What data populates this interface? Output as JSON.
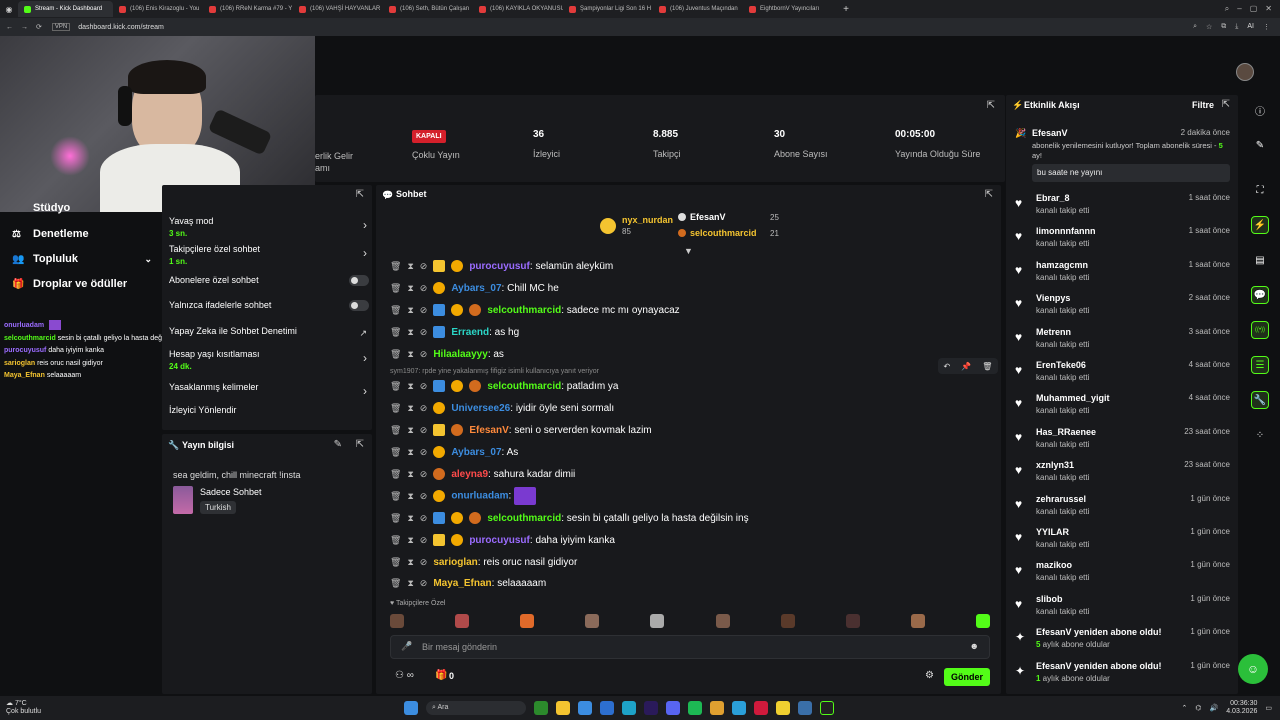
{
  "browser": {
    "tabs": [
      {
        "label": "Stream - Kick Dashboard",
        "active": true,
        "icon": "kick-icon"
      },
      {
        "label": "(106) Enis Kirazoglu - You"
      },
      {
        "label": "(106) RReN Karma #79 - Y"
      },
      {
        "label": "(106) VAHŞİ HAYVANLAR"
      },
      {
        "label": "(106) Seth, Bütün Çalışan"
      },
      {
        "label": "(106) KAYIKLA OKYANUSU"
      },
      {
        "label": "Şampiyonlar Ligi Son 16 H"
      },
      {
        "label": "(106) Juventus Maçından"
      },
      {
        "label": "EightbornV Yayıncıları"
      }
    ],
    "url": "dashboard.kick.com/stream",
    "ai_label": "AI"
  },
  "left_nav": {
    "items": [
      {
        "label": "Stüdyo"
      },
      {
        "label": "Denetleme",
        "icon": "gavel-icon"
      },
      {
        "label": "Topluluk",
        "icon": "users-icon"
      },
      {
        "label": "Droplar ve ödüller",
        "icon": "gift-icon"
      }
    ]
  },
  "overlay_chat": [
    {
      "user": "onurluadam",
      "text": "",
      "color": "#9b6cff"
    },
    {
      "user": "selcouthmarcid",
      "text": "sesin bi çatallı geliyo la hasta değilsin inş",
      "color": "#53fc18"
    },
    {
      "user": "purocuyusuf",
      "text": "daha iyiyim kanka",
      "color": "#9b6cff"
    },
    {
      "user": "sarioglan",
      "text": "reis oruc nasil gidiyor",
      "color": "#f4c430"
    },
    {
      "user": "Maya_Efnan",
      "text": "selaaaaam",
      "color": "#f4c430"
    }
  ],
  "stats": {
    "partial_label_1": "erlik Gelir",
    "partial_label_2": "amı",
    "status_badge": "KAPALI",
    "status_label": "Çoklu Yayın",
    "viewers_value": "36",
    "viewers_label": "İzleyici",
    "followers_value": "8.885",
    "followers_label": "Takipçi",
    "subs_value": "30",
    "subs_label": "Abone Sayısı",
    "uptime_value": "00:05:00",
    "uptime_label": "Yayında Olduğu Süre"
  },
  "chat_settings": {
    "items": [
      {
        "label": "Yavaş mod",
        "sub": "3 sn.",
        "control": "chevron"
      },
      {
        "label": "Takipçilere özel sohbet",
        "sub": "1 sn.",
        "control": "chevron"
      },
      {
        "label": "Abonelere özel sohbet",
        "sub": "",
        "control": "toggle"
      },
      {
        "label": "Yalnızca ifadelerle sohbet",
        "sub": "",
        "control": "toggle"
      },
      {
        "label": "Yapay Zeka ile Sohbet Denetimi",
        "sub": "",
        "control": "external"
      },
      {
        "label": "Hesap yaşı kısıtlaması",
        "sub": "24 dk.",
        "control": "chevron"
      },
      {
        "label": "Yasaklanmış kelimeler",
        "sub": "",
        "control": "chevron"
      },
      {
        "label": "İzleyici Yönlendir",
        "sub": "",
        "control": "none"
      }
    ]
  },
  "stream_info": {
    "title": "Yayın bilgisi",
    "stream_title": "sea geldim, chill minecraft !insta",
    "category": "Sadece Sohbet",
    "language": "Turkish"
  },
  "chat": {
    "title": "Sohbet",
    "leaderboard": [
      {
        "user": "nyx_nurdan",
        "count": "85",
        "color": "#f4c430"
      },
      {
        "user": "EfesanV",
        "count": "25",
        "color": "#ffffff"
      },
      {
        "user": "selcouthmarcid",
        "count": "21",
        "color": "#f4c430"
      }
    ],
    "reply_notice": "sym1907: rpde yine yakalanmış fifigiz isimli kullanıcıya yanıt veriyor",
    "messages": [
      {
        "user": "purocuyusuf",
        "text": "selamün aleyküm",
        "color": "#9b6cff",
        "badges": [
          "crown",
          "one"
        ]
      },
      {
        "user": "Aybars_07",
        "text": "Chill MC he",
        "color": "#3c8de0",
        "badges": [
          "one"
        ]
      },
      {
        "user": "selcouthmarcid",
        "text": "sadece mc mı oynayacaz",
        "color": "#53fc18",
        "badges": [
          "mod",
          "one",
          "lion"
        ]
      },
      {
        "user": "Erraend",
        "text": "as hg",
        "color": "#2bd6c7",
        "badges": [
          "mod"
        ]
      },
      {
        "user": "Hilaalaayyy",
        "text": "as",
        "color": "#53fc18",
        "badges": []
      },
      {
        "user": "selcouthmarcid",
        "text": "patladım ya",
        "color": "#53fc18",
        "badges": [
          "mod",
          "one",
          "lion"
        ]
      },
      {
        "user": "Universee26",
        "text": "iyidir öyle seni sormalı",
        "color": "#3c8de0",
        "badges": [
          "one"
        ]
      },
      {
        "user": "EfesanV",
        "text": "seni o serverden kovmak lazim",
        "color": "#ff8a3c",
        "badges": [
          "crown",
          "lion"
        ]
      },
      {
        "user": "Aybars_07",
        "text": "As",
        "color": "#3c8de0",
        "badges": [
          "one"
        ]
      },
      {
        "user": "aleyna9",
        "text": "sahura kadar dimii",
        "color": "#ff4b4b",
        "badges": [
          "lion"
        ]
      },
      {
        "user": "onurluadam",
        "text": "",
        "color": "#3c8de0",
        "badges": [
          "one"
        ],
        "emote": true
      },
      {
        "user": "selcouthmarcid",
        "text": "sesin bi çatallı geliyo la hasta değilsin inş",
        "color": "#53fc18",
        "badges": [
          "mod",
          "one",
          "lion"
        ]
      },
      {
        "user": "purocuyusuf",
        "text": "daha iyiyim kanka",
        "color": "#9b6cff",
        "badges": [
          "crown",
          "one"
        ]
      },
      {
        "user": "sarioglan",
        "text": "reis oruc nasil gidiyor",
        "color": "#f4c430",
        "badges": []
      },
      {
        "user": "Maya_Efnan",
        "text": "selaaaaam",
        "color": "#f4c430",
        "badges": []
      }
    ],
    "followers_only_label": "Takipçilere Özel",
    "input_placeholder": "Bir mesaj gönderin",
    "gift_count": "0",
    "send_label": "Gönder"
  },
  "activity": {
    "title": "Etkinlik Akışı",
    "filter_label": "Filtre",
    "highlight": {
      "user": "EfesanV",
      "time": "2 dakika önce",
      "text_before": "abonelik yenilemesini kutluyor! Toplam abonelik süresi - ",
      "months": "5",
      "text_after": " ay!",
      "message": "bu saate ne yayını"
    },
    "items": [
      {
        "user": "Ebrar_8",
        "sub": "kanalı takip etti",
        "time": "1 saat önce",
        "icon": "heart-icon"
      },
      {
        "user": "limonnnfannn",
        "sub": "kanalı takip etti",
        "time": "1 saat önce",
        "icon": "heart-icon"
      },
      {
        "user": "hamzagcmn",
        "sub": "kanalı takip etti",
        "time": "1 saat önce",
        "icon": "heart-icon"
      },
      {
        "user": "Vienpys",
        "sub": "kanalı takip etti",
        "time": "2 saat önce",
        "icon": "heart-icon"
      },
      {
        "user": "Metrenn",
        "sub": "kanalı takip etti",
        "time": "3 saat önce",
        "icon": "heart-icon"
      },
      {
        "user": "ErenTeke06",
        "sub": "kanalı takip etti",
        "time": "4 saat önce",
        "icon": "heart-icon"
      },
      {
        "user": "Muhammed_yigit",
        "sub": "kanalı takip etti",
        "time": "4 saat önce",
        "icon": "heart-icon"
      },
      {
        "user": "Has_RRaenee",
        "sub": "kanalı takip etti",
        "time": "23 saat önce",
        "icon": "heart-icon"
      },
      {
        "user": "xznlyn31",
        "sub": "kanalı takip etti",
        "time": "23 saat önce",
        "icon": "heart-icon"
      },
      {
        "user": "zehrarussel",
        "sub": "kanalı takip etti",
        "time": "1 gün önce",
        "icon": "heart-icon"
      },
      {
        "user": "YYILAR",
        "sub": "kanalı takip etti",
        "time": "1 gün önce",
        "icon": "heart-icon"
      },
      {
        "user": "mazikoo",
        "sub": "kanalı takip etti",
        "time": "1 gün önce",
        "icon": "heart-icon"
      },
      {
        "user": "slibob",
        "sub": "kanalı takip etti",
        "time": "1 gün önce",
        "icon": "heart-icon"
      },
      {
        "user": "EfesanV yeniden abone oldu!",
        "sub_num": "5",
        "sub": " aylık abone oldular",
        "time": "1 gün önce",
        "icon": "star-icon"
      },
      {
        "user": "EfesanV yeniden abone oldu!",
        "sub_num": "1",
        "sub": " aylık abone oldular",
        "time": "1 gün önce",
        "icon": "star-icon"
      }
    ]
  },
  "taskbar": {
    "weather_temp": "7°C",
    "weather_text": "Çok bulutlu",
    "search_placeholder": "Ara",
    "time": "00:36:30",
    "date": "4.03.2026"
  },
  "colors": {
    "kick_green": "#53fc18",
    "panel_bg": "#18191c",
    "page_bg": "#0f1012",
    "status_red": "#d4202b"
  }
}
